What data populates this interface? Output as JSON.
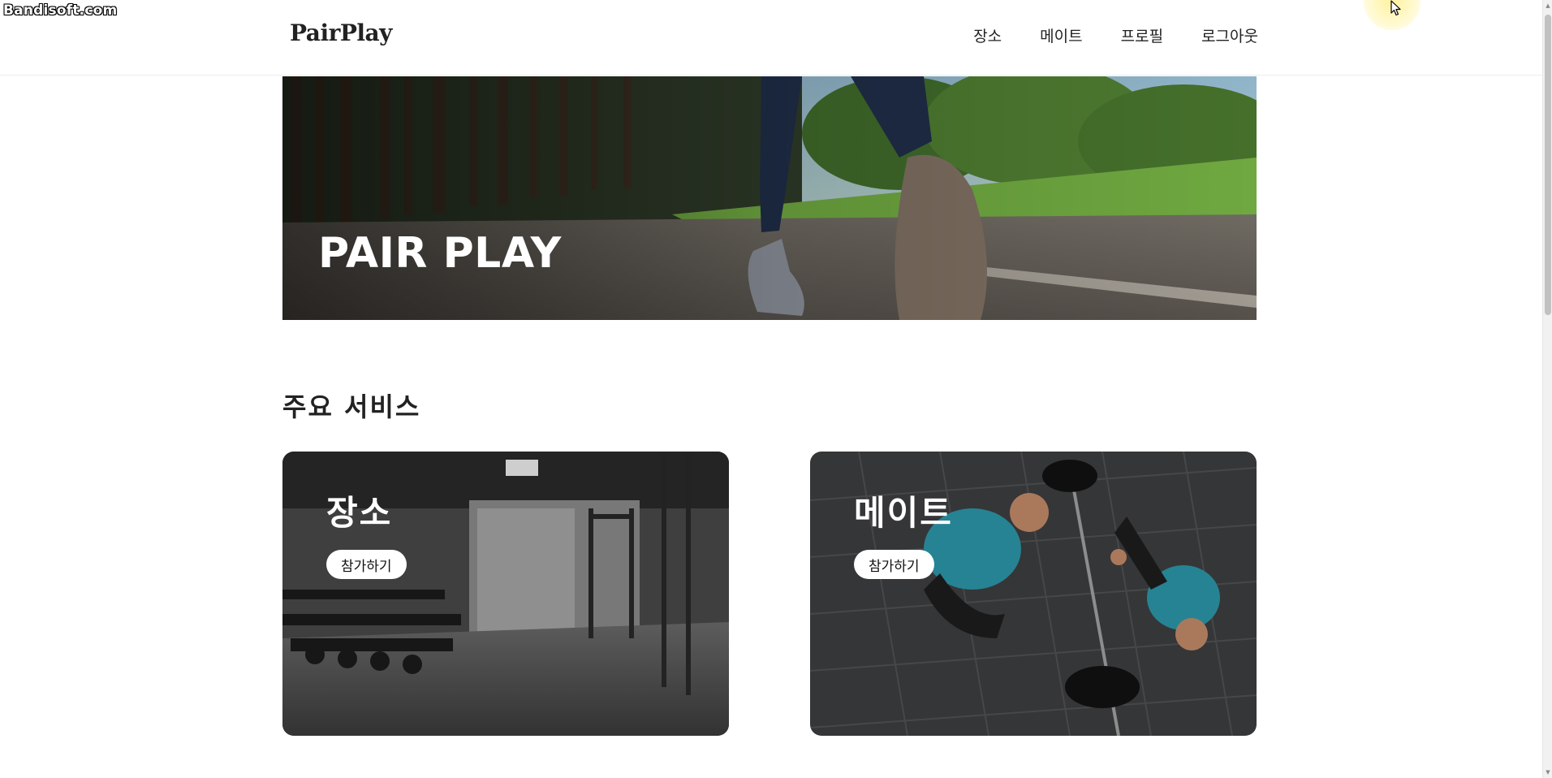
{
  "watermark": "Bandisoft.com",
  "nav": {
    "logo": "PairPlay",
    "items": [
      {
        "label": "장소"
      },
      {
        "label": "메이트"
      },
      {
        "label": "프로필"
      },
      {
        "label": "로그아웃"
      }
    ]
  },
  "hero": {
    "title": "PAIR PLAY"
  },
  "services": {
    "heading": "주요 서비스",
    "cards": [
      {
        "title": "장소",
        "button": "참가하기"
      },
      {
        "title": "메이트",
        "button": "참가하기"
      }
    ]
  },
  "colors": {
    "text": "#222222",
    "button_bg": "#ffffff",
    "hero_overlay": "#3a352f"
  }
}
